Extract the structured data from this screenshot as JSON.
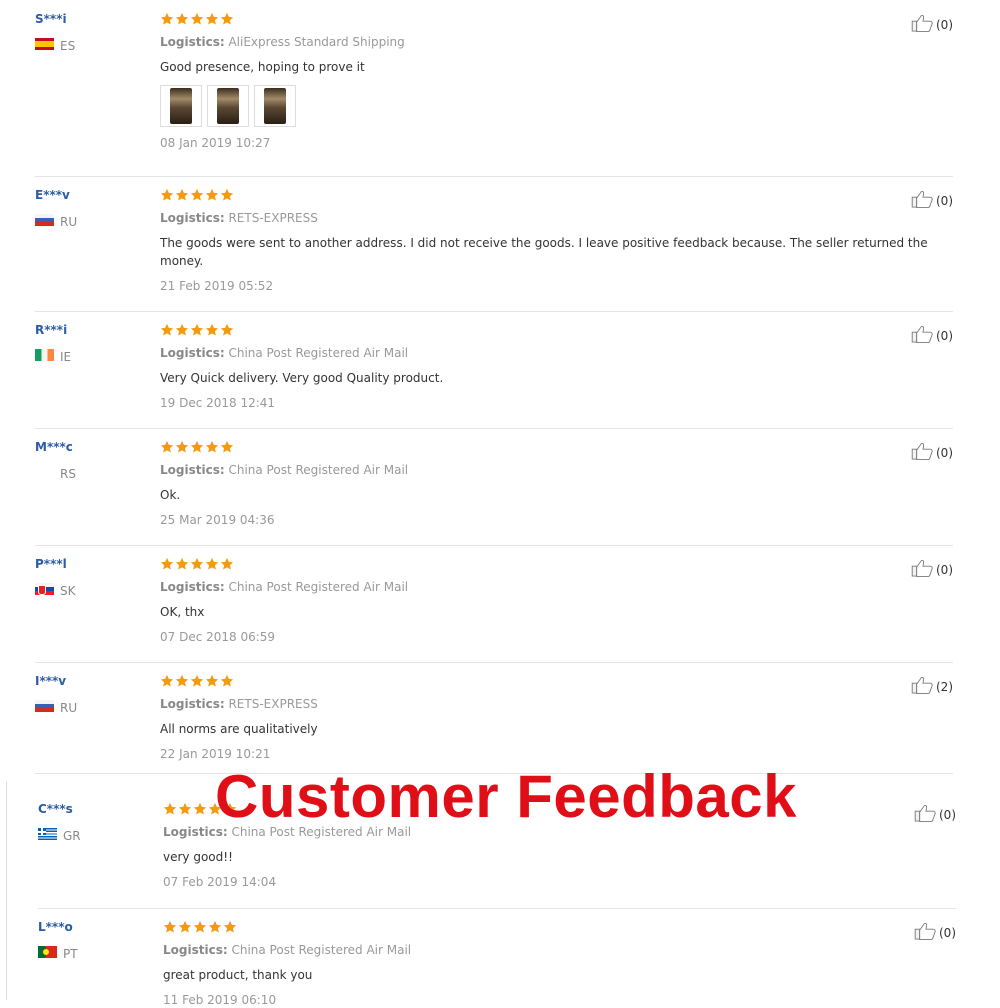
{
  "overlay_title": "Customer Feedback",
  "colors": {
    "star": "#f39a0e",
    "username": "#2b5ca5",
    "overlay": "#e00e16"
  },
  "reviews": [
    {
      "user": "S***i",
      "country": "ES",
      "flag": "es",
      "stars": 5,
      "logistics_label": "Logistics:",
      "logistics": "AliExpress Standard Shipping",
      "text": "Good presence, hoping to prove it",
      "photos": 3,
      "date": "08 Jan 2019 10:27",
      "helpful": "(0)"
    },
    {
      "user": "E***v",
      "country": "RU",
      "flag": "ru",
      "stars": 5,
      "logistics_label": "Logistics:",
      "logistics": "RETS-EXPRESS",
      "text": "The goods were sent to another address. I did not receive the goods. I leave positive feedback because. The seller returned the money.",
      "photos": 0,
      "date": "21 Feb 2019 05:52",
      "helpful": "(0)"
    },
    {
      "user": "R***i",
      "country": "IE",
      "flag": "ie",
      "stars": 5,
      "logistics_label": "Logistics:",
      "logistics": "China Post Registered Air Mail",
      "text": "Very Quick delivery. Very good Quality product.",
      "photos": 0,
      "date": "19 Dec 2018 12:41",
      "helpful": "(0)"
    },
    {
      "user": "M***c",
      "country": "RS",
      "flag": "none",
      "stars": 5,
      "logistics_label": "Logistics:",
      "logistics": "China Post Registered Air Mail",
      "text": "Ok.",
      "photos": 0,
      "date": "25 Mar 2019 04:36",
      "helpful": "(0)"
    },
    {
      "user": "P***l",
      "country": "SK",
      "flag": "sk",
      "stars": 5,
      "logistics_label": "Logistics:",
      "logistics": "China Post Registered Air Mail",
      "text": "OK, thx",
      "photos": 0,
      "date": "07 Dec 2018 06:59",
      "helpful": "(0)"
    },
    {
      "user": "I***v",
      "country": "RU",
      "flag": "ru",
      "stars": 5,
      "logistics_label": "Logistics:",
      "logistics": "RETS-EXPRESS",
      "text": "All norms are qualitatively",
      "photos": 0,
      "date": "22 Jan 2019 10:21",
      "helpful": "(2)"
    },
    {
      "user": "C***s",
      "country": "GR",
      "flag": "gr",
      "stars": 5,
      "logistics_label": "Logistics:",
      "logistics": "China Post Registered Air Mail",
      "text": "very good!!",
      "photos": 0,
      "date": "07 Feb 2019 14:04",
      "helpful": "(0)"
    },
    {
      "user": "L***o",
      "country": "PT",
      "flag": "pt",
      "stars": 5,
      "logistics_label": "Logistics:",
      "logistics": "China Post Registered Air Mail",
      "text": "great product, thank you",
      "photos": 0,
      "date": "11 Feb 2019 06:10",
      "helpful": "(0)"
    }
  ]
}
